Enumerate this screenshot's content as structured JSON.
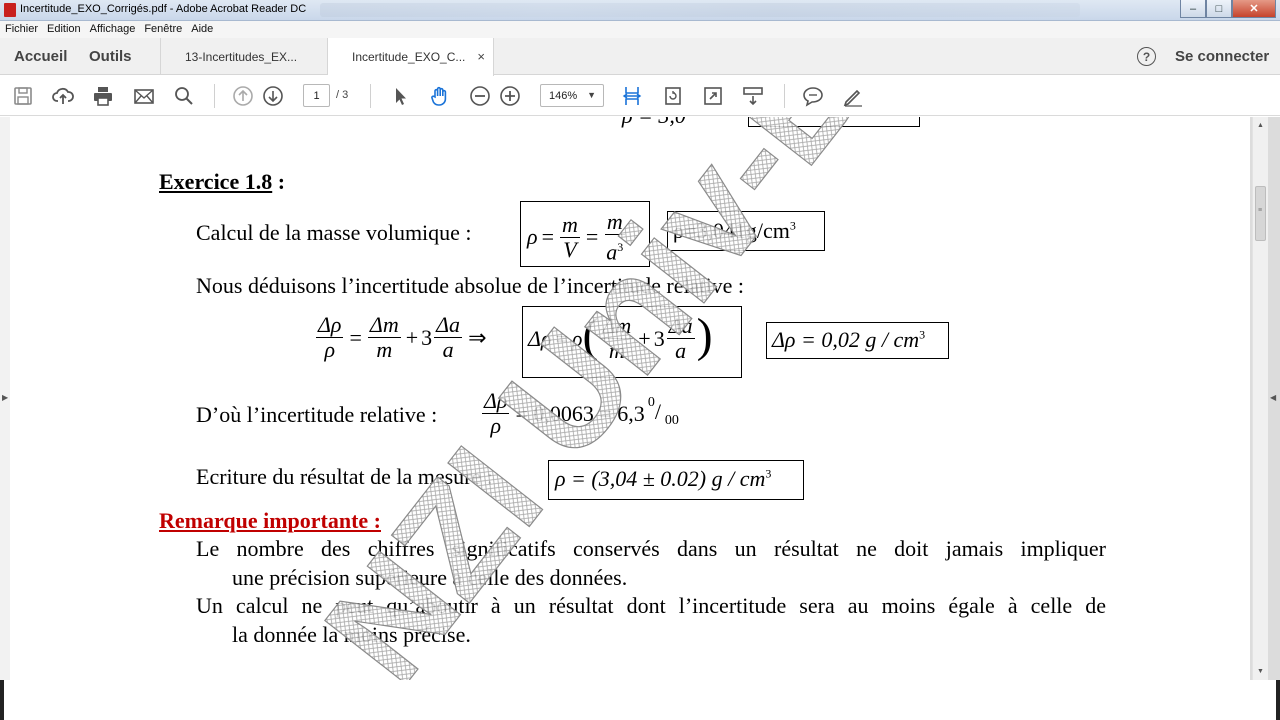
{
  "window": {
    "title": "Incertitude_EXO_Corrigés.pdf - Adobe Acrobat Reader DC",
    "min": "–",
    "max": "□",
    "close": "✕"
  },
  "menu": [
    "Fichier",
    "Edition",
    "Affichage",
    "Fenêtre",
    "Aide"
  ],
  "tabs": {
    "home": "Accueil",
    "tools": "Outils",
    "doc1": "13-Incertitudes_EX...",
    "doc2": "Incertitude_EXO_C...",
    "close": "×",
    "help": "?",
    "signin": "Se connecter"
  },
  "toolbar": {
    "page_current": "1",
    "page_total": "/ 3",
    "zoom": "146%",
    "zoom_caret": "▼"
  },
  "document": {
    "top_cut": "ρ = 3,0",
    "exercise_title": "Exercice 1.8",
    "exercise_colon": " :",
    "density_label": "Calcul de la masse volumique :",
    "density_formula": {
      "rho": "ρ",
      "m": "m",
      "V": "V",
      "a3": "a",
      "exp": "3"
    },
    "density_result": "ρ=3,041g/cm",
    "density_result_exp": "3",
    "deduce_text": "Nous déduisons l’incertitude absolue de l’incertitude relative :",
    "uncert_eq": {
      "drho": "Δρ",
      "rho": "ρ",
      "dm": "Δm",
      "m": "m",
      "three": "3",
      "da": "Δa",
      "a": "a",
      "arrow": "⇒"
    },
    "uncert_result": "Δρ = 0,02",
    "uncert_unit": "g / cm",
    "uncert_unit_exp": "3",
    "relative_label": "D’où l’incertitude relative :",
    "relative_value": "= 0,0063 = 6,3",
    "relative_permil": "0",
    "relative_permil_sub": "00",
    "result_label": "Ecriture du résultat de la mesure :",
    "result_formula": "ρ = (3,04 ± 0.02)",
    "result_unit": "g / cm",
    "result_unit_exp": "3",
    "remark_title": "Remarque importante :",
    "remark_1a": "Le nombre des chiffres significatifs conservés dans un résultat ne doit jamais impliquer",
    "remark_1b": "une précision supérieure à celle des données.",
    "remark_2a": "Un calcul ne peut qu’aboutir à un résultat dont l’incertitude sera au moins égale à celle de",
    "remark_2b": "la donnée la moins précise.",
    "watermark": "NZI Univ-BECHAR"
  }
}
